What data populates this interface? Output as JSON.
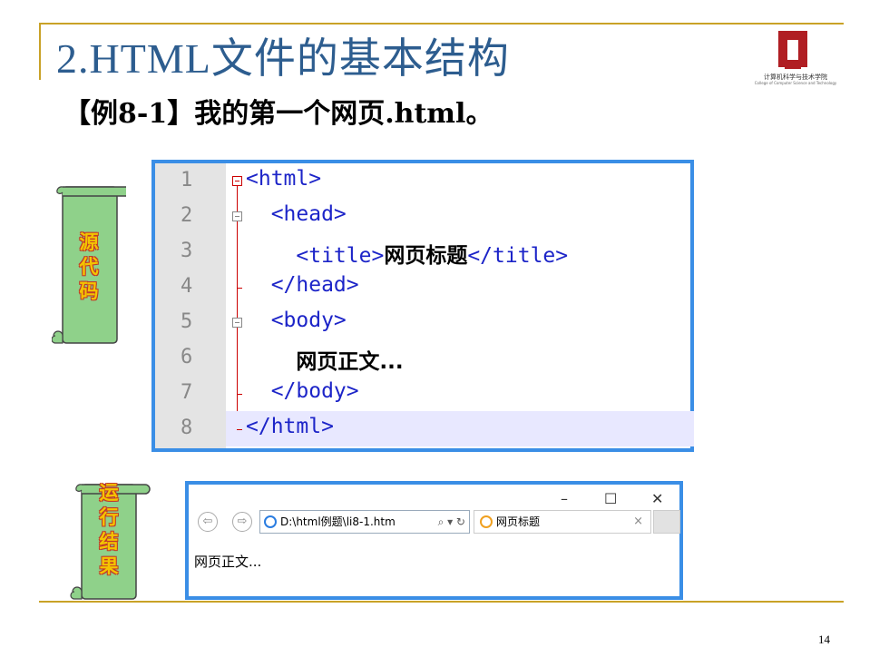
{
  "slide": {
    "title": "2.HTML文件的基本结构",
    "subtitle": "【例8-1】我的第一个网页.html。",
    "page_number": "14",
    "accent_color": "#c9a227",
    "title_color": "#2d5d8f"
  },
  "logo": {
    "text": "计算机科学与技术学院",
    "subtext": "College of Computer Science and Technology",
    "color": "#b01e23"
  },
  "scrolls": {
    "source": {
      "label": "源代码",
      "color": "#8fd18a"
    },
    "result": {
      "label": "运行结果",
      "color": "#8fd18a"
    }
  },
  "code": {
    "lines": [
      {
        "num": "1",
        "pre": "<html>",
        "text": "",
        "post": ""
      },
      {
        "num": "2",
        "pre": "  <head>",
        "text": "",
        "post": ""
      },
      {
        "num": "3",
        "pre": "    <title>",
        "text": "网页标题",
        "post": "</title>"
      },
      {
        "num": "4",
        "pre": "  </head>",
        "text": "",
        "post": ""
      },
      {
        "num": "5",
        "pre": "  <body>",
        "text": "",
        "post": ""
      },
      {
        "num": "6",
        "pre": "    ",
        "text": "网页正文...",
        "post": ""
      },
      {
        "num": "7",
        "pre": "  </body>",
        "text": "",
        "post": ""
      },
      {
        "num": "8",
        "pre": "</html>",
        "text": "",
        "post": ""
      }
    ]
  },
  "browser": {
    "minimize": "–",
    "maximize": "☐",
    "close": "✕",
    "back_icon": "back-arrow-icon",
    "forward_icon": "forward-arrow-icon",
    "address": "D:\\html例题\\li8-1.htm",
    "address_controls": "⌕ ▾ ↻",
    "tab_title": "网页标题",
    "tab_close": "×",
    "body_text": "网页正文..."
  }
}
